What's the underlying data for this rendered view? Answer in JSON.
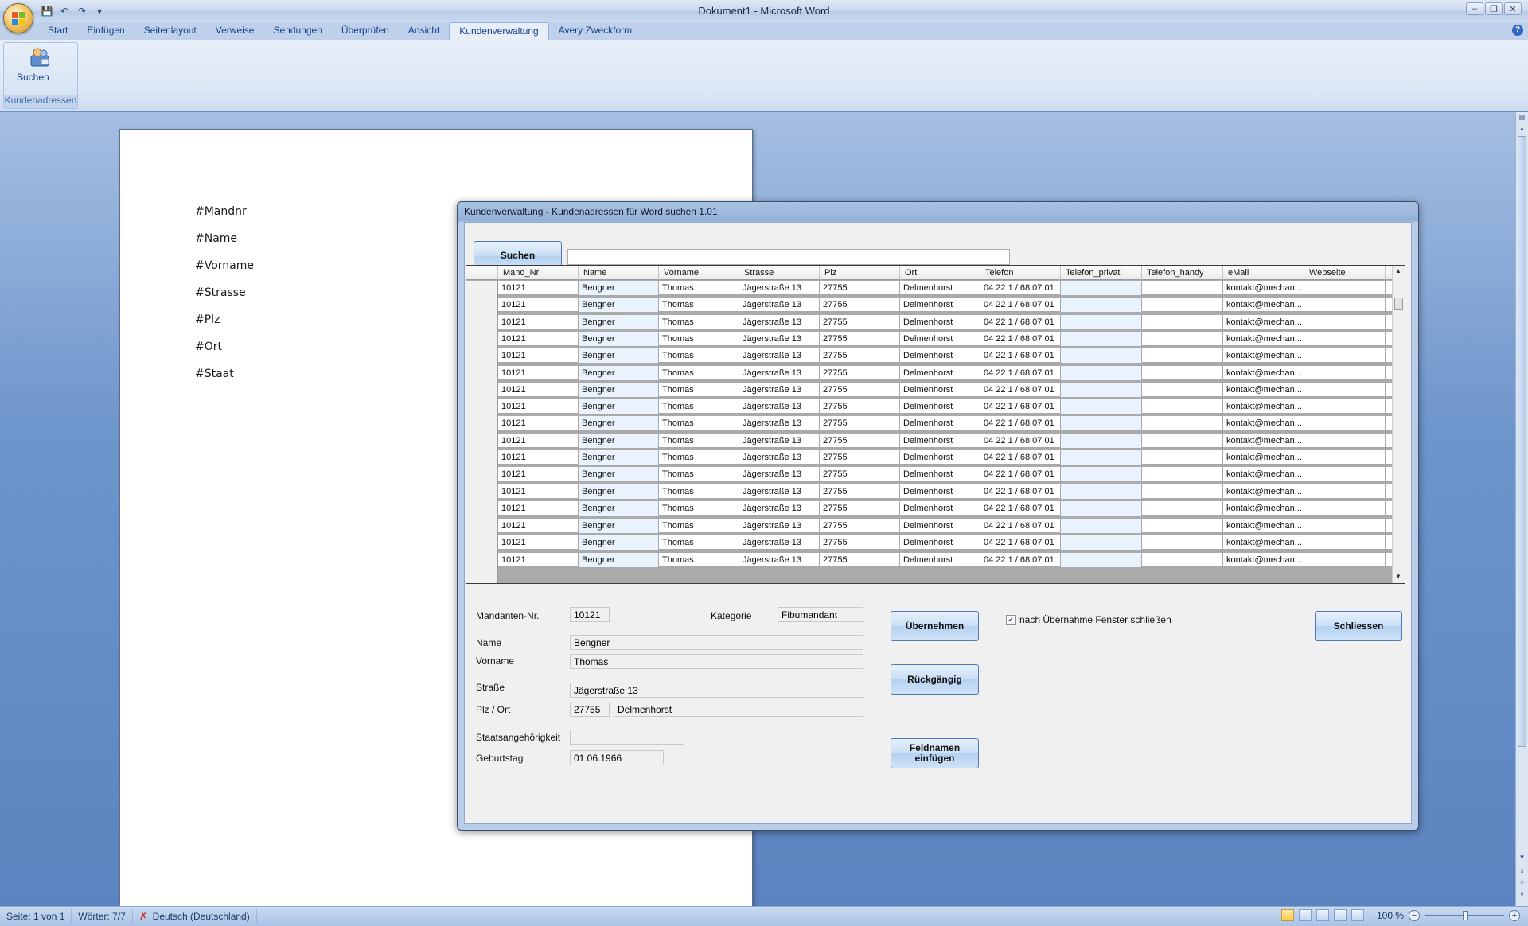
{
  "window": {
    "title": "Dokument1 - Microsoft Word"
  },
  "ribbon": {
    "tabs": [
      "Start",
      "Einfügen",
      "Seitenlayout",
      "Verweise",
      "Sendungen",
      "Überprüfen",
      "Ansicht",
      "Kundenverwaltung",
      "Avery Zweckform"
    ],
    "active_tab": "Kundenverwaltung",
    "group": {
      "button_label": "Suchen",
      "label": "Kundenadressen"
    }
  },
  "document": {
    "fields": [
      "#Mandnr",
      "#Name",
      "#Vorname",
      "#Strasse",
      "#Plz",
      "#Ort",
      "#Staat"
    ]
  },
  "dialog": {
    "title": "Kundenverwaltung - Kundenadressen für Word suchen 1.01",
    "search_button": "Suchen",
    "search_value": "",
    "grid": {
      "columns": [
        "Mand_Nr",
        "Name",
        "Vorname",
        "Strasse",
        "Plz",
        "Ort",
        "Telefon",
        "Telefon_privat",
        "Telefon_handy",
        "eMail",
        "Webseite"
      ],
      "rows": [
        [
          "10121",
          "Bengner",
          "Thomas",
          "Jägerstraße 13",
          "27755",
          "Delmenhorst",
          "04 22 1 / 68 07 01",
          "",
          "",
          "kontakt@mechan...",
          ""
        ],
        [
          "10121",
          "Bengner",
          "Thomas",
          "Jägerstraße 13",
          "27755",
          "Delmenhorst",
          "04 22 1 / 68 07 01",
          "",
          "",
          "kontakt@mechan...",
          ""
        ],
        [
          "10121",
          "Bengner",
          "Thomas",
          "Jägerstraße 13",
          "27755",
          "Delmenhorst",
          "04 22 1 / 68 07 01",
          "",
          "",
          "kontakt@mechan...",
          ""
        ],
        [
          "10121",
          "Bengner",
          "Thomas",
          "Jägerstraße 13",
          "27755",
          "Delmenhorst",
          "04 22 1 / 68 07 01",
          "",
          "",
          "kontakt@mechan...",
          ""
        ],
        [
          "10121",
          "Bengner",
          "Thomas",
          "Jägerstraße 13",
          "27755",
          "Delmenhorst",
          "04 22 1 / 68 07 01",
          "",
          "",
          "kontakt@mechan...",
          ""
        ],
        [
          "10121",
          "Bengner",
          "Thomas",
          "Jägerstraße 13",
          "27755",
          "Delmenhorst",
          "04 22 1 / 68 07 01",
          "",
          "",
          "kontakt@mechan...",
          ""
        ],
        [
          "10121",
          "Bengner",
          "Thomas",
          "Jägerstraße 13",
          "27755",
          "Delmenhorst",
          "04 22 1 / 68 07 01",
          "",
          "",
          "kontakt@mechan...",
          ""
        ],
        [
          "10121",
          "Bengner",
          "Thomas",
          "Jägerstraße 13",
          "27755",
          "Delmenhorst",
          "04 22 1 / 68 07 01",
          "",
          "",
          "kontakt@mechan...",
          ""
        ],
        [
          "10121",
          "Bengner",
          "Thomas",
          "Jägerstraße 13",
          "27755",
          "Delmenhorst",
          "04 22 1 / 68 07 01",
          "",
          "",
          "kontakt@mechan...",
          ""
        ],
        [
          "10121",
          "Bengner",
          "Thomas",
          "Jägerstraße 13",
          "27755",
          "Delmenhorst",
          "04 22 1 / 68 07 01",
          "",
          "",
          "kontakt@mechan...",
          ""
        ],
        [
          "10121",
          "Bengner",
          "Thomas",
          "Jägerstraße 13",
          "27755",
          "Delmenhorst",
          "04 22 1 / 68 07 01",
          "",
          "",
          "kontakt@mechan...",
          ""
        ],
        [
          "10121",
          "Bengner",
          "Thomas",
          "Jägerstraße 13",
          "27755",
          "Delmenhorst",
          "04 22 1 / 68 07 01",
          "",
          "",
          "kontakt@mechan...",
          ""
        ],
        [
          "10121",
          "Bengner",
          "Thomas",
          "Jägerstraße 13",
          "27755",
          "Delmenhorst",
          "04 22 1 / 68 07 01",
          "",
          "",
          "kontakt@mechan...",
          ""
        ],
        [
          "10121",
          "Bengner",
          "Thomas",
          "Jägerstraße 13",
          "27755",
          "Delmenhorst",
          "04 22 1 / 68 07 01",
          "",
          "",
          "kontakt@mechan...",
          ""
        ],
        [
          "10121",
          "Bengner",
          "Thomas",
          "Jägerstraße 13",
          "27755",
          "Delmenhorst",
          "04 22 1 / 68 07 01",
          "",
          "",
          "kontakt@mechan...",
          ""
        ],
        [
          "10121",
          "Bengner",
          "Thomas",
          "Jägerstraße 13",
          "27755",
          "Delmenhorst",
          "04 22 1 / 68 07 01",
          "",
          "",
          "kontakt@mechan...",
          ""
        ],
        [
          "10121",
          "Bengner",
          "Thomas",
          "Jägerstraße 13",
          "27755",
          "Delmenhorst",
          "04 22 1 / 68 07 01",
          "",
          "",
          "kontakt@mechan...",
          ""
        ]
      ]
    },
    "form": {
      "mandant_label": "Mandanten-Nr.",
      "mandant_value": "10121",
      "kategorie_label": "Kategorie",
      "kategorie_value": "Fibumandant",
      "name_label": "Name",
      "name_value": "Bengner",
      "vorname_label": "Vorname",
      "vorname_value": "Thomas",
      "strasse_label": "Straße",
      "strasse_value": "Jägerstraße 13",
      "plzort_label": "Plz / Ort",
      "plz_value": "27755",
      "ort_value": "Delmenhorst",
      "staat_label": "Staatsangehörigkeit",
      "staat_value": "",
      "geburtstag_label": "Geburtstag",
      "geburtstag_value": "01.06.1966"
    },
    "buttons": {
      "uebernehmen": "Übernehmen",
      "rueckgaengig": "Rückgängig",
      "feldnamen_line1": "Feldnamen",
      "feldnamen_line2": "einfügen",
      "schliessen": "Schliessen"
    },
    "checkbox": {
      "label": "nach Übernahme Fenster schließen",
      "checked": true,
      "mark": "✓"
    }
  },
  "statusbar": {
    "page": "Seite: 1 von 1",
    "words": "Wörter: 7/7",
    "language": "Deutsch (Deutschland)",
    "zoom": "100 %",
    "zoom_minus": "−",
    "zoom_plus": "+"
  },
  "colors": {
    "accent": "#15428b",
    "grid_alt": "#eaf3fd"
  }
}
